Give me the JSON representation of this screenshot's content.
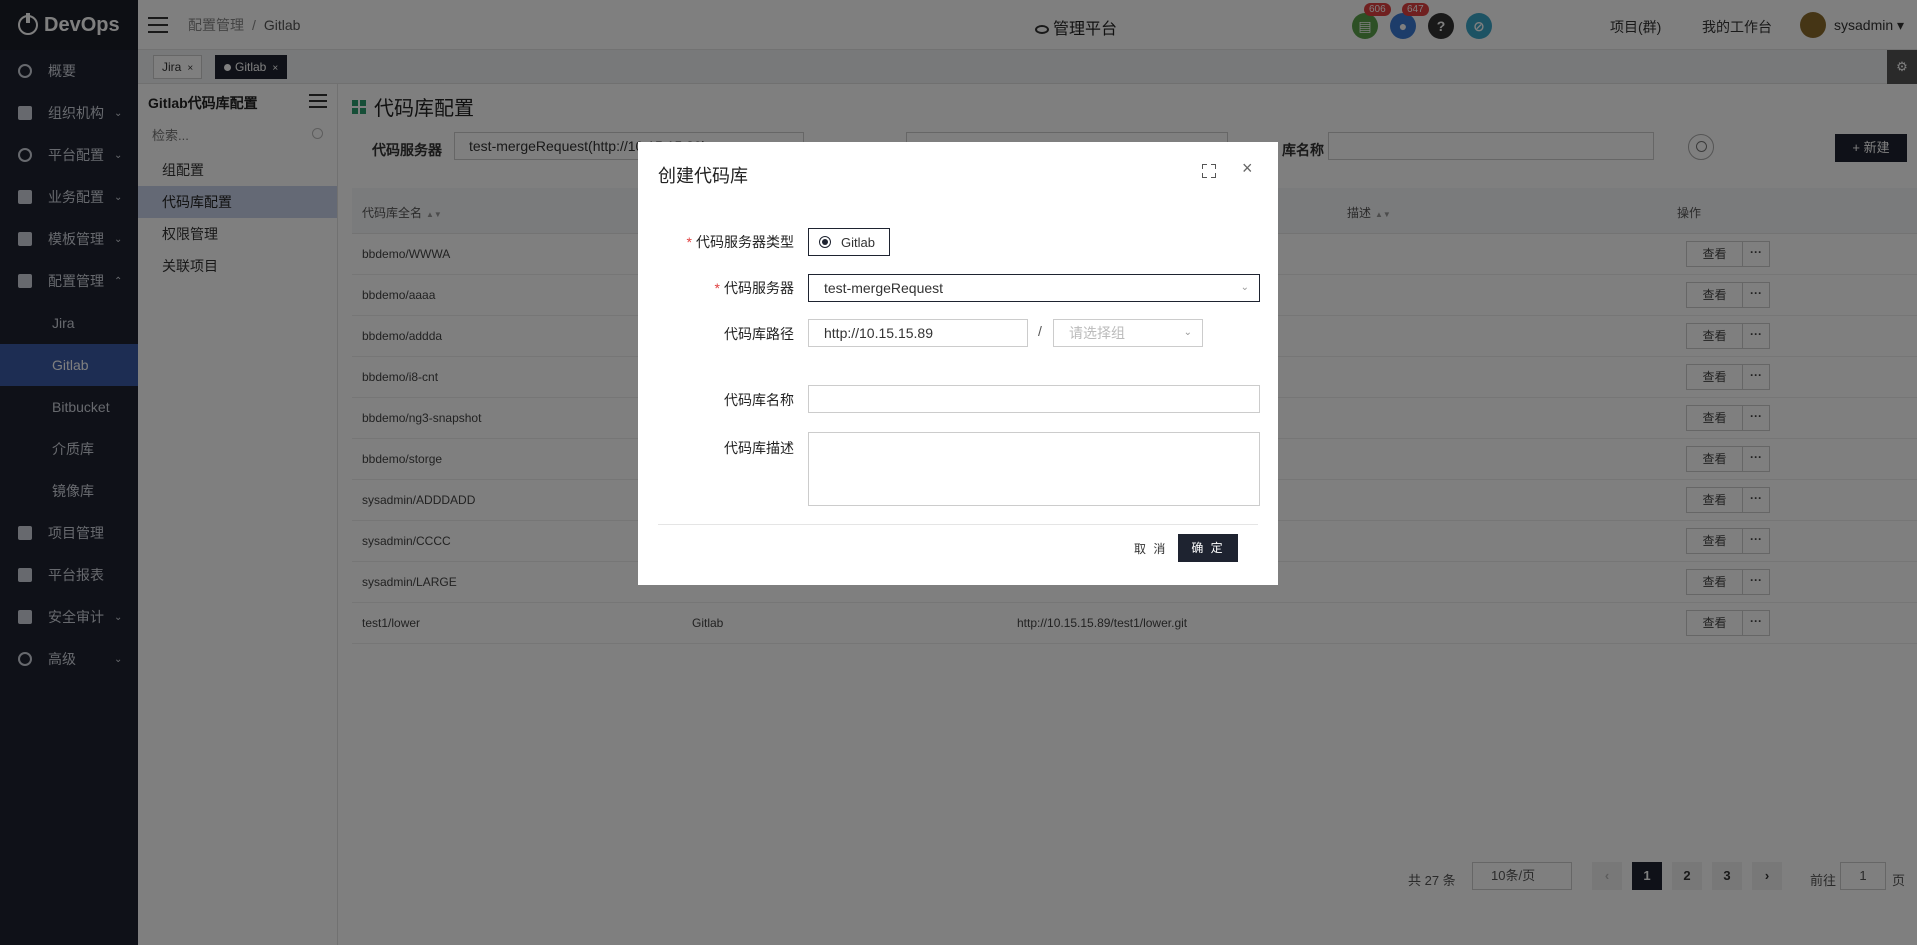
{
  "app": {
    "logo": "DevOps"
  },
  "sidebar": {
    "items": [
      {
        "label": "概要",
        "chevron": ""
      },
      {
        "label": "组织机构",
        "chevron": "⌄"
      },
      {
        "label": "平台配置",
        "chevron": "⌄"
      },
      {
        "label": "业务配置",
        "chevron": "⌄"
      },
      {
        "label": "模板管理",
        "chevron": "⌄"
      },
      {
        "label": "配置管理",
        "chevron": "⌃"
      },
      {
        "label": "Jira",
        "chevron": ""
      },
      {
        "label": "Gitlab",
        "chevron": ""
      },
      {
        "label": "Bitbucket",
        "chevron": ""
      },
      {
        "label": "介质库",
        "chevron": ""
      },
      {
        "label": "镜像库",
        "chevron": ""
      },
      {
        "label": "项目管理",
        "chevron": ""
      },
      {
        "label": "平台报表",
        "chevron": ""
      },
      {
        "label": "安全审计",
        "chevron": "⌄"
      },
      {
        "label": "高级",
        "chevron": "⌄"
      }
    ]
  },
  "header": {
    "breadcrumb": [
      "配置管理",
      "Gitlab"
    ],
    "breadcrumb_sep": "/",
    "platform": "管理平台",
    "badges": {
      "docs": "606",
      "bell": "647"
    },
    "help": "?",
    "project": "项目(群)",
    "workspace": "我的工作台",
    "user": "sysadmin",
    "user_caret": "▾"
  },
  "tabs": [
    {
      "label": "Jira",
      "close": "×"
    },
    {
      "label": "Gitlab",
      "close": "×"
    }
  ],
  "gear": "⚙",
  "subsidebar": {
    "title": "Gitlab代码库配置",
    "search_placeholder": "检索...",
    "items": [
      "组配置",
      "代码库配置",
      "权限管理",
      "关联项目"
    ]
  },
  "main": {
    "title": "代码库配置",
    "filter": {
      "server_label": "代码服务器",
      "server_value": "test-mergeRequest(http://10.15.15.89)",
      "name_label": "库名称"
    },
    "new_button": "+ 新建",
    "columns": [
      "代码库全名",
      "描述",
      "操作"
    ],
    "rows": [
      {
        "name": "bbdemo/WWWA",
        "type": "",
        "url": ""
      },
      {
        "name": "bbdemo/aaaa",
        "type": "",
        "url": ""
      },
      {
        "name": "bbdemo/addda",
        "type": "",
        "url": ""
      },
      {
        "name": "bbdemo/i8-cnt",
        "type": "",
        "url": ""
      },
      {
        "name": "bbdemo/ng3-snapshot",
        "type": "",
        "url": ""
      },
      {
        "name": "bbdemo/storge",
        "type": "",
        "url": ""
      },
      {
        "name": "sysadmin/ADDDADD",
        "type": "",
        "url": ""
      },
      {
        "name": "sysadmin/CCCC",
        "type": "",
        "url": ""
      },
      {
        "name": "sysadmin/LARGE",
        "type": "",
        "url": ""
      },
      {
        "name": "test1/lower",
        "type": "Gitlab",
        "url": "http://10.15.15.89/test1/lower.git"
      }
    ],
    "view_label": "查看",
    "more_label": "···",
    "pager": {
      "total": "共 27 条",
      "page_size": "10条/页",
      "pages": [
        "1",
        "2",
        "3"
      ],
      "prev": "‹",
      "next": "›",
      "goto": "前往",
      "goto_value": "1",
      "page_suffix": "页"
    }
  },
  "modal": {
    "title": "创建代码库",
    "close": "×",
    "server_type_label": "代码服务器类型",
    "server_type_option": "Gitlab",
    "server_label": "代码服务器",
    "server_value": "test-mergeRequest",
    "path_label": "代码库路径",
    "path_value": "http://10.15.15.89",
    "path_sep": "/",
    "group_placeholder": "请选择组",
    "name_label": "代码库名称",
    "desc_label": "代码库描述",
    "cancel": "取 消",
    "ok": "确 定",
    "required_mark": "*"
  }
}
